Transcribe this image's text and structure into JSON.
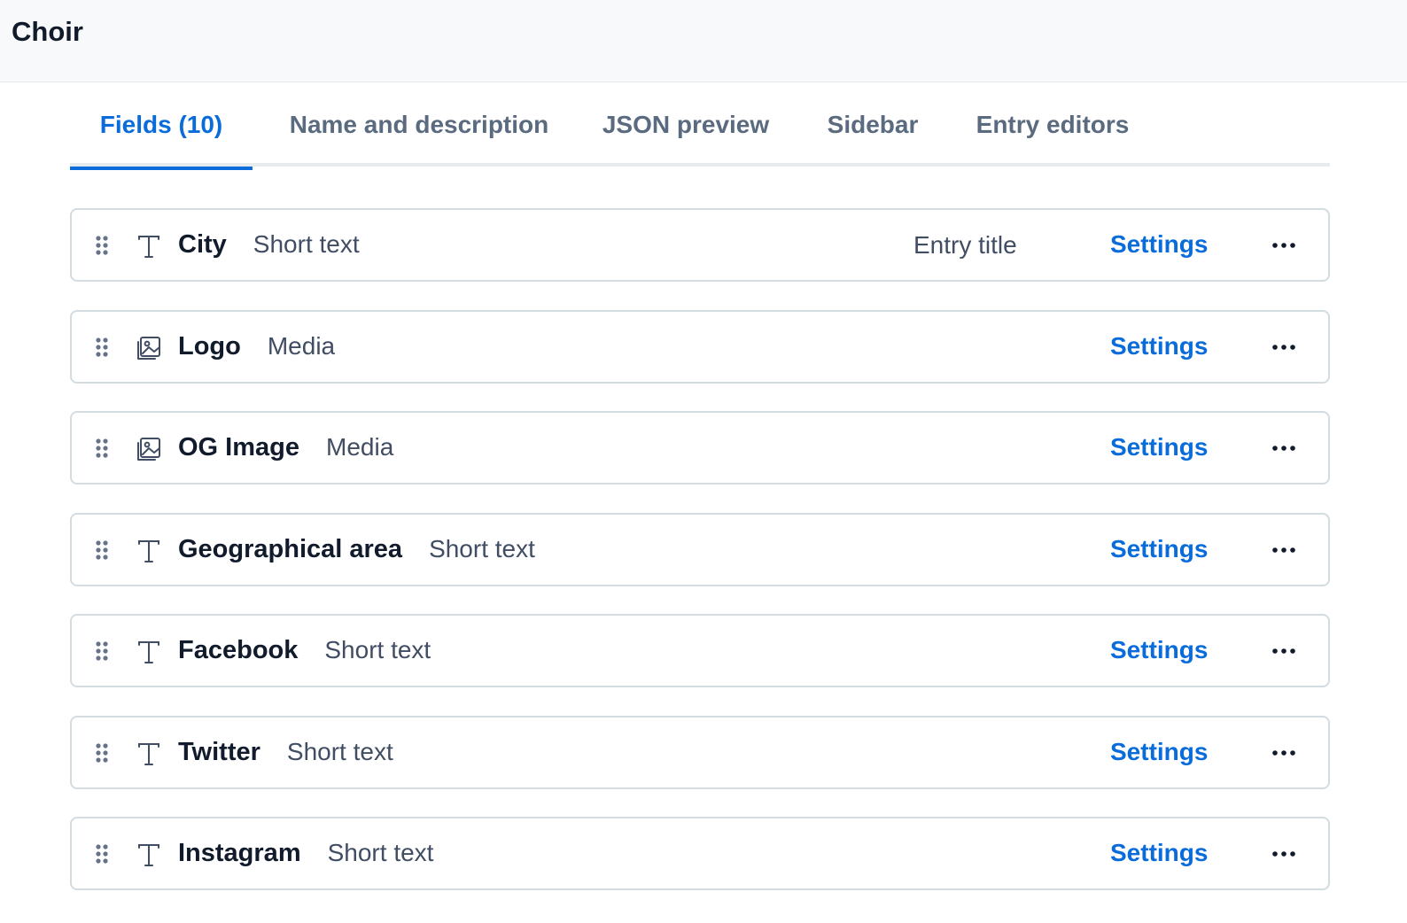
{
  "header": {
    "title": "Choir"
  },
  "tabs": [
    {
      "label": "Fields (10)",
      "active": true
    },
    {
      "label": "Name and description",
      "active": false
    },
    {
      "label": "JSON preview",
      "active": false
    },
    {
      "label": "Sidebar",
      "active": false
    },
    {
      "label": "Entry editors",
      "active": false
    }
  ],
  "fields": [
    {
      "name": "City",
      "type": "Short text",
      "icon": "text-icon",
      "badge": "Entry title",
      "settings_label": "Settings"
    },
    {
      "name": "Logo",
      "type": "Media",
      "icon": "media-icon",
      "settings_label": "Settings"
    },
    {
      "name": "OG Image",
      "type": "Media",
      "icon": "media-icon",
      "settings_label": "Settings"
    },
    {
      "name": "Geographical area",
      "type": "Short text",
      "icon": "text-icon",
      "settings_label": "Settings"
    },
    {
      "name": "Facebook",
      "type": "Short text",
      "icon": "text-icon",
      "settings_label": "Settings"
    },
    {
      "name": "Twitter",
      "type": "Short text",
      "icon": "text-icon",
      "settings_label": "Settings"
    },
    {
      "name": "Instagram",
      "type": "Short text",
      "icon": "text-icon",
      "settings_label": "Settings"
    }
  ],
  "colors": {
    "accent": "#0a6cdb",
    "text_primary": "#111b2b",
    "text_secondary": "#414d63",
    "border": "#d3dce0",
    "header_bg": "#f7f9fa"
  }
}
